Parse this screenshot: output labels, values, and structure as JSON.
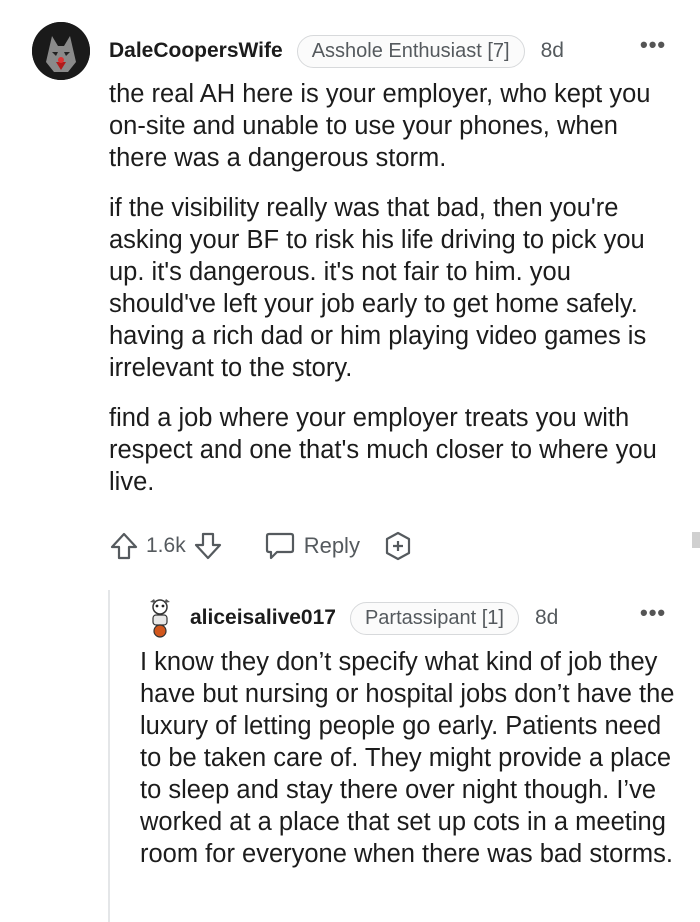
{
  "comment": {
    "username": "DaleCoopersWife",
    "flair": "Asshole Enthusiast [7]",
    "age": "8d",
    "paragraphs": [
      "the real AH here is your employer, who kept you on-site and unable to use your phones, when there was a dangerous storm.",
      "if the visibility really was that bad, then you're asking your BF to risk his life driving to pick you up. it's dangerous. it's not fair to him. you should've left your job early to get home safely. having a rich dad or him playing video games is irrelevant to the story.",
      "find a job where your employer treats you with respect and one that's much closer to where you live."
    ],
    "votes": "1.6k",
    "reply_label": "Reply",
    "more_label": "•••"
  },
  "reply": {
    "username": "aliceisalive017",
    "flair": "Partassipant [1]",
    "age": "8d",
    "more_label": "•••",
    "text": "I know they don’t specify what kind of job they have but nursing or hospital jobs don’t have the luxury of letting people go early. Patients need to be taken care of. They might provide a place to sleep and stay there over night though. I’ve worked at a place that set up cots in a meeting room for everyone when there was bad storms."
  },
  "icons": {
    "upvote": "upvote-arrow-icon",
    "downvote": "downvote-arrow-icon",
    "reply": "speech-bubble-icon",
    "award": "award-plus-icon",
    "more": "more-options-icon"
  }
}
